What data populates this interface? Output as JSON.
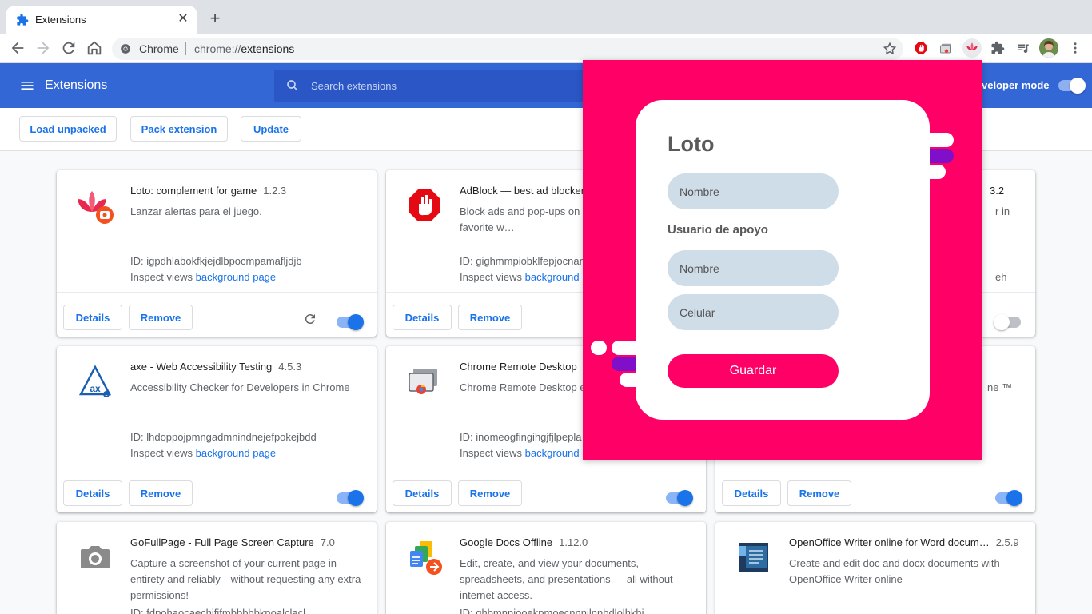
{
  "browser": {
    "tab_title": "Extensions",
    "tab_close": "✕",
    "new_tab": "+",
    "omnibox_chip": "Chrome",
    "url_scheme": "chrome://",
    "url_path": "extensions"
  },
  "header": {
    "title": "Extensions",
    "search_placeholder": "Search extensions",
    "dev_mode_label": "veloper mode"
  },
  "actions": {
    "load_unpacked": "Load unpacked",
    "pack_extension": "Pack extension",
    "update": "Update"
  },
  "cards": [
    {
      "name": "Loto: complement for game",
      "version": "1.2.3",
      "description": "Lanzar alertas para el juego.",
      "id": "ID: igpdhlabokfkjejdlbpocmpamafljdjb",
      "inspect": "Inspect views",
      "inspect_link": "background page",
      "details": "Details",
      "remove": "Remove",
      "enabled": true
    },
    {
      "name": "AdBlock — best ad blocker",
      "version": "",
      "description": "Block ads and pop-ups on Y… Twitch, and your favorite w…",
      "id": "ID: gighmmpiobklfepjocnam",
      "inspect": "Inspect views",
      "inspect_link": "background",
      "details": "Details",
      "remove": "Remove",
      "enabled": true
    },
    {
      "name": "",
      "version": "3.2",
      "description": "r in",
      "id": "",
      "inspect": "eh",
      "inspect_link": "",
      "details": "",
      "remove": "",
      "enabled": false
    },
    {
      "name": "axe - Web Accessibility Testing",
      "version": "4.5.3",
      "description": "Accessibility Checker for Developers in Chrome",
      "id": "ID: lhdoppojpmngadmnindnejefpokejbdd",
      "inspect": "Inspect views",
      "inspect_link": "background page",
      "details": "Details",
      "remove": "Remove",
      "enabled": true
    },
    {
      "name": "Chrome Remote Desktop",
      "version": "",
      "description": "Chrome Remote Desktop e",
      "id": "ID: inomeogfingihgjfjlpepla",
      "inspect": "Inspect views",
      "inspect_link": "background",
      "details": "Details",
      "remove": "Remove",
      "enabled": true
    },
    {
      "name": "",
      "version": "",
      "description": "ne ™",
      "id": "",
      "inspect": "",
      "inspect_link": "",
      "details": "Details",
      "remove": "Remove",
      "enabled": true
    },
    {
      "name": "GoFullPage - Full Page Screen Capture",
      "version": "7.0",
      "description": "Capture a screenshot of your current page in entirety and reliably—without requesting any extra permissions!",
      "id": "ID: fdpohaocaechififmbbbbbknoalclacl",
      "inspect": "",
      "inspect_link": "",
      "details": "",
      "remove": "",
      "enabled": true
    },
    {
      "name": "Google Docs Offline",
      "version": "1.12.0",
      "description": "Edit, create, and view your documents, spreadsheets, and presentations — all without internet access.",
      "id": "ID: ghbmnnjooekpmoecnnnilnnbdlolhkhi",
      "inspect": "",
      "inspect_link": "",
      "details": "",
      "remove": "",
      "enabled": true
    },
    {
      "name": "OpenOffice Writer online for Word docum…",
      "version": "2.5.9",
      "description": "Create and edit doc and docx documents with OpenOffice Writer online",
      "id": "",
      "inspect": "",
      "inspect_link": "",
      "details": "",
      "remove": "",
      "enabled": true
    }
  ],
  "popup": {
    "title": "Loto",
    "name_placeholder": "Nombre",
    "support_label": "Usuario de apoyo",
    "support_name_placeholder": "Nombre",
    "phone_placeholder": "Celular",
    "save": "Guardar"
  },
  "colors": {
    "header_blue": "#3367d6",
    "popup_pink": "#ff0066",
    "field_blue": "#cfdde8",
    "purple": "#7f0fc9",
    "link_blue": "#1a73e8"
  }
}
